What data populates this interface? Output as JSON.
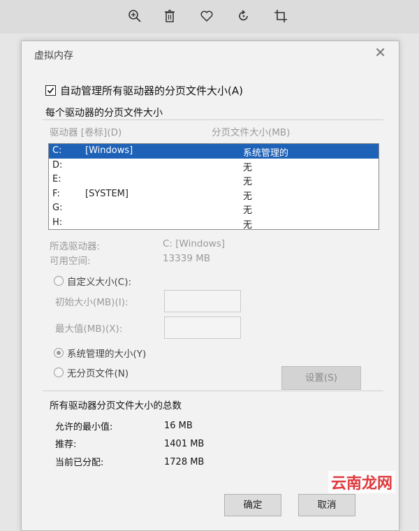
{
  "dialog": {
    "title": "虚拟内存",
    "auto_manage_label": "自动管理所有驱动器的分页文件大小(A)",
    "group_label": "每个驱动器的分页文件大小",
    "col_drive": "驱动器 [卷标](D)",
    "col_size": "分页文件大小(MB)",
    "drives": [
      {
        "letter": "C:",
        "label": "[Windows]",
        "size": "系统管理的"
      },
      {
        "letter": "D:",
        "label": "",
        "size": "无"
      },
      {
        "letter": "E:",
        "label": "",
        "size": "无"
      },
      {
        "letter": "F:",
        "label": "[SYSTEM]",
        "size": "无"
      },
      {
        "letter": "G:",
        "label": "",
        "size": "无"
      },
      {
        "letter": "H:",
        "label": "",
        "size": "无"
      }
    ],
    "selected_drive_label": "所选驱动器:",
    "selected_drive_value": "C: [Windows]",
    "free_space_label": "可用空间:",
    "free_space_value": "13339 MB",
    "custom_size_label": "自定义大小(C):",
    "initial_size_label": "初始大小(MB)(I):",
    "max_size_label": "最大值(MB)(X):",
    "system_managed_label": "系统管理的大小(Y)",
    "no_paging_label": "无分页文件(N)",
    "set_button": "设置(S)",
    "total_title": "所有驱动器分页文件大小的总数",
    "min_allowed_label": "允许的最小值:",
    "min_allowed_value": "16 MB",
    "recommended_label": "推荐:",
    "recommended_value": "1401 MB",
    "allocated_label": "当前已分配:",
    "allocated_value": "1728 MB",
    "ok_button": "确定",
    "cancel_button": "取消"
  },
  "watermark": "云南龙网",
  "toolbar_icons": [
    "zoom-in-icon",
    "delete-icon",
    "favorite-icon",
    "rotate-icon",
    "crop-icon"
  ]
}
